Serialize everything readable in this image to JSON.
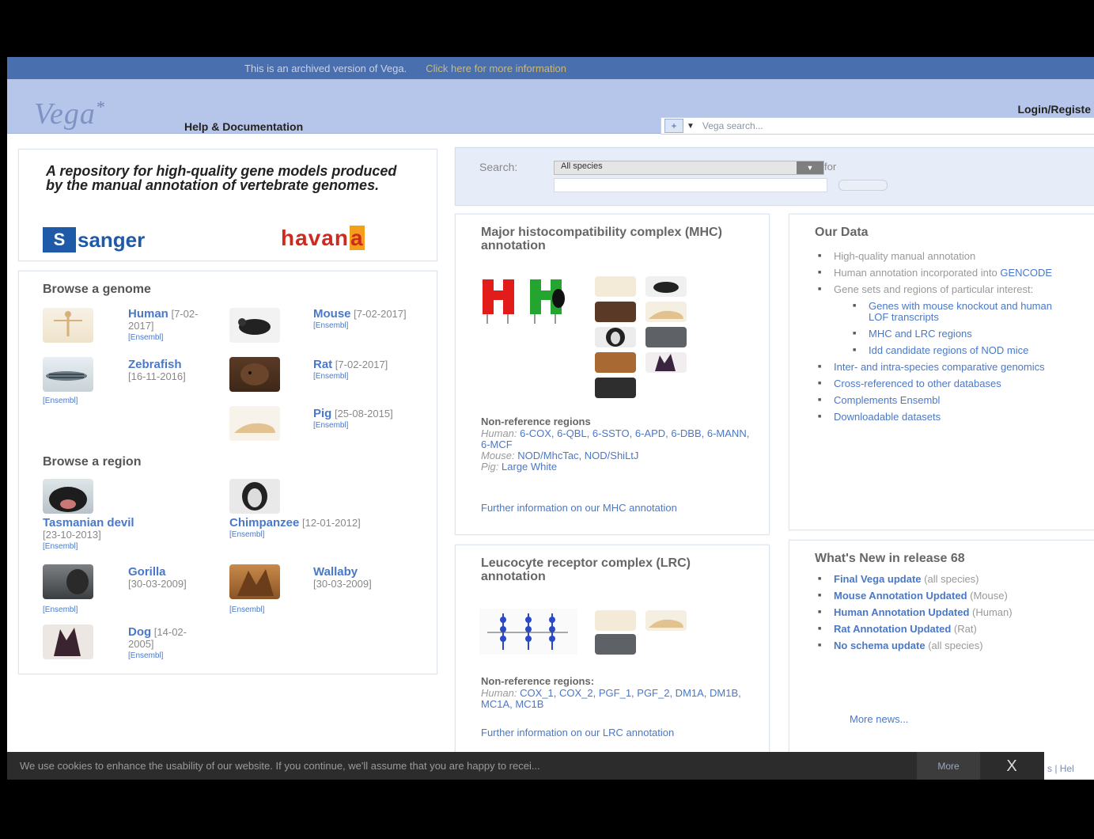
{
  "archive_bar": {
    "text": "This is an archived version of Vega.",
    "link": "Click here for more information"
  },
  "header": {
    "logo": "Vega",
    "logo_star": "*",
    "help": "Help & Documentation",
    "login": "Login/Registe",
    "search_placeholder": "Vega search..."
  },
  "intro": {
    "tagline": "A repository for high-quality gene models produced by the manual annotation of vertebrate genomes.",
    "sanger_mark": "S",
    "sanger_word": "sanger",
    "havana_a": "havan",
    "havana_b": "a"
  },
  "browse_genome": {
    "title": "Browse a genome",
    "species": [
      {
        "name": "Human",
        "date": "[7-02-2017]",
        "ensembl": "[Ensembl]"
      },
      {
        "name": "Mouse",
        "date": "[7-02-2017]",
        "ensembl": "[Ensembl]"
      },
      {
        "name": "Zebrafish",
        "date": "[16-11-2016]",
        "ensembl": "[Ensembl]"
      },
      {
        "name": "Rat",
        "date": "[7-02-2017]",
        "ensembl": "[Ensembl]"
      },
      {
        "name": "Pig",
        "date": "[25-08-2015]",
        "ensembl": "[Ensembl]"
      }
    ]
  },
  "browse_region": {
    "title": "Browse a region",
    "species": [
      {
        "name": "Tasmanian devil",
        "date": "[23-10-2013]",
        "ensembl": "[Ensembl]"
      },
      {
        "name": "Chimpanzee",
        "date": "[12-01-2012]",
        "ensembl": "[Ensembl]"
      },
      {
        "name": "Gorilla",
        "date": "[30-03-2009]",
        "ensembl": "[Ensembl]"
      },
      {
        "name": "Wallaby",
        "date": "[30-03-2009]",
        "ensembl": "[Ensembl]"
      },
      {
        "name": "Dog",
        "date": "[14-02-2005]",
        "ensembl": "[Ensembl]"
      }
    ]
  },
  "search": {
    "label": "Search:",
    "selected": "All species",
    "for": "for"
  },
  "mhc": {
    "title": "Major histocompatibility complex (MHC) annotation",
    "nr_label": "Non-reference regions",
    "human_label": "Human:",
    "human_links": "6-COX, 6-QBL, 6-SSTO, 6-APD, 6-DBB, 6-MANN, 6-MCF",
    "mouse_label": "Mouse:",
    "mouse_links": "NOD/MhcTac, NOD/ShiLtJ",
    "pig_label": "Pig:",
    "pig_links": "Large White",
    "further": "Further information on our MHC annotation"
  },
  "lrc": {
    "title": "Leucocyte receptor complex (LRC) annotation",
    "nr_label": "Non-reference regions:",
    "human_label": "Human:",
    "human_links": "COX_1, COX_2, PGF_1, PGF_2, DM1A, DM1B, MC1A, MC1B",
    "further": "Further information on our LRC annotation"
  },
  "our_data": {
    "title": "Our Data",
    "items": [
      "High-quality manual annotation",
      "Human annotation incorporated into",
      "Gene sets and regions of particular interest:",
      "Genes with mouse knockout and human LOF transcripts",
      "MHC and LRC regions",
      "Idd candidate regions of NOD mice",
      "Inter- and intra-species comparative genomics",
      "Cross-referenced to other databases",
      "Complements Ensembl",
      "Downloadable datasets"
    ],
    "gencode": "GENCODE"
  },
  "news": {
    "title": "What's New in release 68",
    "items": [
      {
        "link": "Final Vega update",
        "note": "(all species)"
      },
      {
        "link": "Mouse Annotation Updated",
        "note": "(Mouse)"
      },
      {
        "link": "Human Annotation Updated",
        "note": "(Human)"
      },
      {
        "link": "Rat Annotation Updated",
        "note": "(Rat)"
      },
      {
        "link": "No schema update",
        "note": "(all species)"
      }
    ],
    "more": "More news..."
  },
  "cookie": {
    "text": "We use cookies to enhance the usability of our website. If you continue, we'll assume that you are happy to recei...",
    "more": "More",
    "close": "X"
  },
  "footer_peek": "s | Hel"
}
